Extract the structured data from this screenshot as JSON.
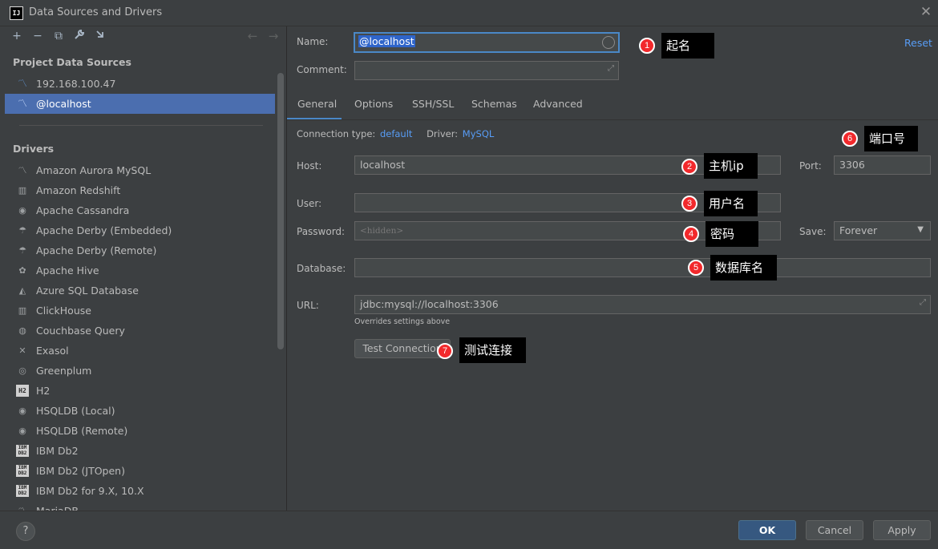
{
  "window": {
    "title": "Data Sources and Drivers",
    "logo_text": "IJ"
  },
  "toolbar": {
    "add": "+",
    "remove": "−",
    "copy": "⧉",
    "wrench": "🔧",
    "import": "⬃",
    "back": "←",
    "forward": "→"
  },
  "project_data_sources": {
    "heading": "Project Data Sources",
    "items": [
      {
        "label": "192.168.100.47",
        "icon": "mysql-icon"
      },
      {
        "label": "@localhost",
        "icon": "mysql-icon",
        "selected": true
      }
    ]
  },
  "drivers": {
    "heading": "Drivers",
    "items": [
      {
        "label": "Amazon Aurora MySQL",
        "icon": "aurora-icon"
      },
      {
        "label": "Amazon Redshift",
        "icon": "redshift-icon"
      },
      {
        "label": "Apache Cassandra",
        "icon": "cassandra-icon"
      },
      {
        "label": "Apache Derby (Embedded)",
        "icon": "derby-icon"
      },
      {
        "label": "Apache Derby (Remote)",
        "icon": "derby-icon"
      },
      {
        "label": "Apache Hive",
        "icon": "hive-icon"
      },
      {
        "label": "Azure SQL Database",
        "icon": "azure-icon"
      },
      {
        "label": "ClickHouse",
        "icon": "clickhouse-icon"
      },
      {
        "label": "Couchbase Query",
        "icon": "couchbase-icon"
      },
      {
        "label": "Exasol",
        "icon": "exasol-icon"
      },
      {
        "label": "Greenplum",
        "icon": "greenplum-icon"
      },
      {
        "label": "H2",
        "icon": "h2-icon"
      },
      {
        "label": "HSQLDB (Local)",
        "icon": "hsqldb-icon"
      },
      {
        "label": "HSQLDB (Remote)",
        "icon": "hsqldb-icon"
      },
      {
        "label": "IBM Db2",
        "icon": "db2-icon"
      },
      {
        "label": "IBM Db2 (JTOpen)",
        "icon": "db2-icon"
      },
      {
        "label": "IBM Db2 for 9.X, 10.X",
        "icon": "db2-icon"
      },
      {
        "label": "MariaDB",
        "icon": "mariadb-icon"
      }
    ]
  },
  "form": {
    "name_label": "Name:",
    "name_value": "@localhost",
    "comment_label": "Comment:",
    "comment_value": "",
    "reset_label": "Reset",
    "tabs": [
      "General",
      "Options",
      "SSH/SSL",
      "Schemas",
      "Advanced"
    ],
    "active_tab": "General",
    "connection_type_label": "Connection type:",
    "connection_type_value": "default",
    "driver_label": "Driver:",
    "driver_value": "MySQL",
    "host_label": "Host:",
    "host_value": "localhost",
    "port_label": "Port:",
    "port_value": "3306",
    "user_label": "User:",
    "user_value": "",
    "password_label": "Password:",
    "password_placeholder": "<hidden>",
    "save_label": "Save:",
    "save_value": "Forever",
    "database_label": "Database:",
    "database_value": "",
    "url_label": "URL:",
    "url_value": "jdbc:mysql://localhost:3306",
    "url_note": "Overrides settings above",
    "test_connection_label": "Test Connection"
  },
  "buttons": {
    "help": "?",
    "ok": "OK",
    "cancel": "Cancel",
    "apply": "Apply"
  },
  "annotations": [
    {
      "num": "1",
      "text": "起名"
    },
    {
      "num": "2",
      "text": "主机ip"
    },
    {
      "num": "3",
      "text": "用户名"
    },
    {
      "num": "4",
      "text": "密码"
    },
    {
      "num": "5",
      "text": "数据库名"
    },
    {
      "num": "6",
      "text": "端口号"
    },
    {
      "num": "7",
      "text": "测试连接"
    }
  ],
  "colors": {
    "accent": "#4a88c7",
    "selection": "#4b6eaf",
    "link": "#589df6",
    "badge": "#f2292c",
    "ok_button": "#365880"
  }
}
